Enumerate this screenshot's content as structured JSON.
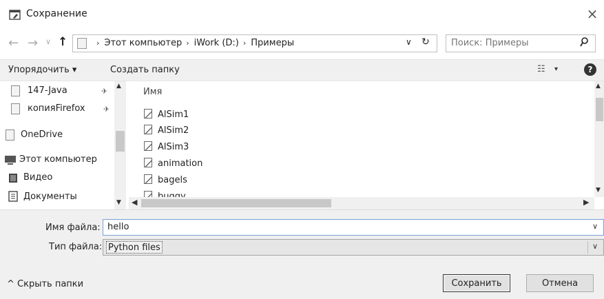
{
  "window": {
    "title": "Сохранение",
    "close": "×"
  },
  "nav": {
    "back": "←",
    "forward": "→",
    "recent": "∨",
    "up": "↑"
  },
  "address": {
    "segments": [
      "Этот компьютер",
      "iWork (D:)",
      "Примеры"
    ],
    "separator": "›",
    "dropdown": "∨",
    "refresh": "↻"
  },
  "search": {
    "placeholder": "Поиск: Примеры",
    "icon": "⚲"
  },
  "toolbar": {
    "organize": "Упорядочить ▾",
    "new_folder": "Создать папку",
    "view_icon": "☷",
    "view_arrow": "▾",
    "help": "?"
  },
  "sidebar": {
    "items": [
      {
        "label": "147-Java",
        "pinned": true
      },
      {
        "label": "копияFirefox",
        "pinned": true
      },
      {
        "label": "OneDrive",
        "pinned": false
      },
      {
        "label": "Этот компьютер",
        "pinned": false
      },
      {
        "label": "Видео",
        "pinned": false
      },
      {
        "label": "Документы",
        "pinned": false
      }
    ],
    "pin_icon": "✈"
  },
  "files": {
    "column": "Имя",
    "items": [
      "AlSim1",
      "AlSim2",
      "AlSim3",
      "animation",
      "bagels",
      "buggy"
    ]
  },
  "form": {
    "filename_label": "Имя файла:",
    "filename_value": "hello",
    "filetype_label": "Тип файла:",
    "filetype_value": "Python files",
    "arrow": "∨"
  },
  "footer": {
    "hide_folders": "^ Скрыть папки",
    "save": "Сохранить",
    "cancel": "Отмена"
  },
  "colors": {
    "toolbar_bg": "#f0f0f0",
    "field_border": "#7a9fd6"
  }
}
